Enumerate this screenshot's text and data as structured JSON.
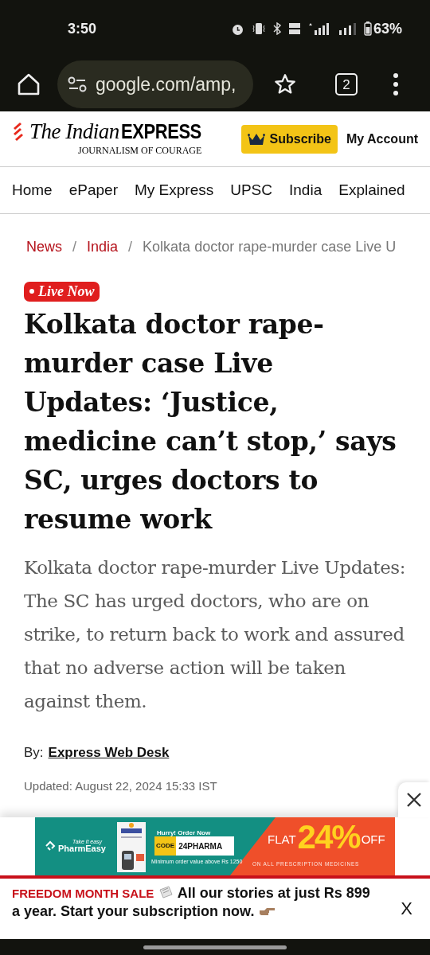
{
  "status_bar": {
    "time": "3:50",
    "battery": "63%"
  },
  "browser": {
    "url": "google.com/amp,",
    "tab_count": "2"
  },
  "header": {
    "logo_the_indian": "The Indian",
    "logo_express": "EXPRESS",
    "tagline": "JOURNALISM OF COURAGE",
    "subscribe": "Subscribe",
    "account": "My Account"
  },
  "nav": [
    "Home",
    "ePaper",
    "My Express",
    "UPSC",
    "India",
    "Explained"
  ],
  "breadcrumb_separator": "/",
  "breadcrumb": [
    {
      "label": "News",
      "kind": "link"
    },
    {
      "label": "India",
      "kind": "link"
    },
    {
      "label": "Kolkata doctor rape-murder case Live U",
      "kind": "current"
    }
  ],
  "article": {
    "badge": "Live Now",
    "headline": "Kolkata doctor rape-murder case Live Updates: ‘Justice, medicine can’t stop,’ says SC, urges doctors to resume work",
    "summary": "Kolkata doctor rape-murder Live Updates: The SC has urged doctors, who are on strike, to return back to work and assured that no adverse action will be taken against them.",
    "byline_prefix": "By:",
    "author": "Express Web Desk",
    "updated": "Updated: August 22, 2024 15:33 IST"
  },
  "ad": {
    "tagline": "Take it easy",
    "brand": "PharmEasy",
    "hurry": "Hurry! Order Now",
    "code_label": "CODE",
    "code": "24PHARMA",
    "min_order": "Minimum order value above Rs 1250",
    "flat": "FLAT",
    "percent": "24%",
    "off": "OFF",
    "subline": "ON ALL PRESCRIPTION MEDICINES"
  },
  "promo": {
    "sale": "FREEDOM MONTH SALE",
    "message": "All our stories at just Rs 899 a year. Start your subscription now.",
    "close": "X"
  }
}
